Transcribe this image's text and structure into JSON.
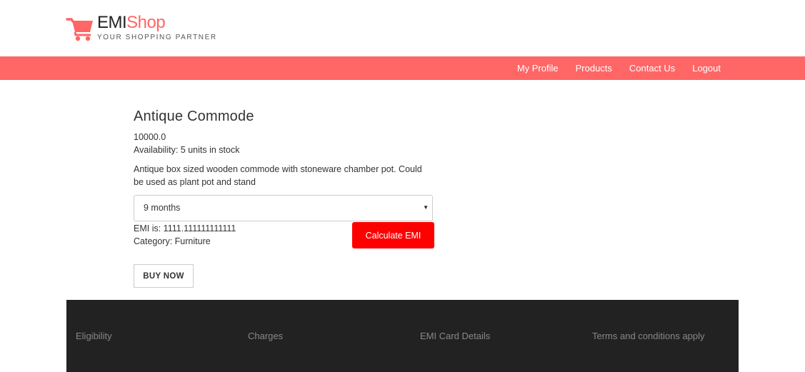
{
  "brand": {
    "name_primary": "EMI",
    "name_secondary": "Shop",
    "tagline": "YOUR SHOPPING PARTNER",
    "icon": "shopping-cart-icon",
    "accent_color": "#ff6666"
  },
  "nav": {
    "items": [
      {
        "label": "My Profile"
      },
      {
        "label": "Products"
      },
      {
        "label": "Contact Us"
      },
      {
        "label": "Logout"
      }
    ]
  },
  "product": {
    "title": "Antique Commode",
    "price": "10000.0",
    "availability": "Availability: 5 units in stock",
    "description": "Antique box sized wooden commode with stoneware chamber pot. Could be used as plant pot and stand",
    "emi_select": {
      "selected": "9 months"
    },
    "emi_result": "EMI is: 1111.111111111111",
    "category": "Category: Furniture",
    "calculate_label": "Calculate EMI",
    "buy_label": "BUY NOW",
    "calculate_color": "#ff0000"
  },
  "footer": {
    "items": [
      {
        "label": "Eligibility"
      },
      {
        "label": "Charges"
      },
      {
        "label": "EMI Card Details"
      },
      {
        "label": "Terms and conditions apply"
      }
    ],
    "background": "#222222"
  }
}
